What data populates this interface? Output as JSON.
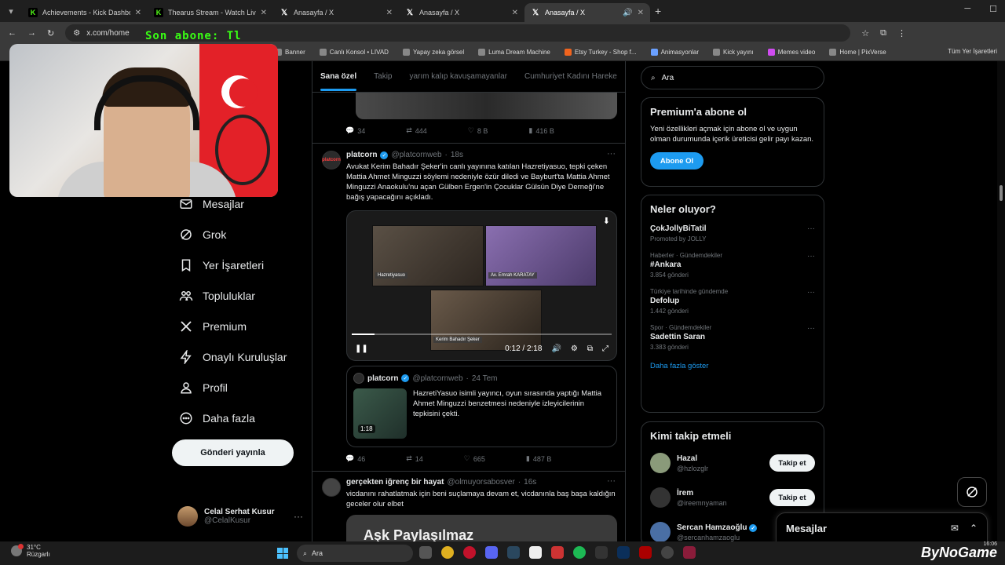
{
  "browser": {
    "tabs": [
      {
        "label": "Achievements - Kick Dashboard",
        "icon": "kick-icon",
        "active": false
      },
      {
        "label": "Thearus Stream - Watch Live on",
        "icon": "kick-icon",
        "active": false
      },
      {
        "label": "Anasayfa / X",
        "icon": "x-logo-icon",
        "active": false
      },
      {
        "label": "Anasayfa / X",
        "icon": "x-logo-icon",
        "active": false
      },
      {
        "label": "Anasayfa / X",
        "icon": "x-logo-icon",
        "active": true
      }
    ],
    "url": "x.com/home",
    "bookmarks": [
      "Banner",
      "Canlı Konsol • LIVAD",
      "Yapay zeka görsel",
      "Luma Dream Machine",
      "Etsy Turkey - Shop f...",
      "Animasyonlar",
      "Kick yayını",
      "Memes video",
      "Home | PixVerse"
    ],
    "bookmarks_right": "Tüm Yer İşaretleri"
  },
  "overlay": {
    "text": "Son abone: Tl"
  },
  "nav": {
    "items": [
      {
        "label": "Mesajlar",
        "icon": "mail-icon"
      },
      {
        "label": "Grok",
        "icon": "grok-icon"
      },
      {
        "label": "Yer İşaretleri",
        "icon": "bookmark-icon"
      },
      {
        "label": "Topluluklar",
        "icon": "communities-icon"
      },
      {
        "label": "Premium",
        "icon": "x-logo-icon"
      },
      {
        "label": "Onaylı Kuruluşlar",
        "icon": "lightning-icon"
      },
      {
        "label": "Profil",
        "icon": "user-icon"
      },
      {
        "label": "Daha fazla",
        "icon": "more-circle-icon"
      }
    ],
    "post_button": "Gönderi yayınla",
    "profile": {
      "name": "Celal Serhat Kusur",
      "handle": "@CelalKusur"
    }
  },
  "feed": {
    "tabs": [
      "Sana özel",
      "Takip",
      "yarım kalıp kavuşamayanlar",
      "Cumhuriyet Kadını Hareke"
    ],
    "prev_actions": {
      "replies": "34",
      "reposts": "444",
      "likes": "8 B",
      "views": "416 B"
    },
    "tweet1": {
      "name": "platcorn",
      "handle": "@platcornweb",
      "time": "18s",
      "avatar_text": "platcorn",
      "text": "Avukat Kerim Bahadır Şeker'in canlı yayınına katılan Hazretiyasuo, tepki çeken Mattia Ahmet Minguzzi söylemi nedeniyle özür diledi ve Bayburt'ta Mattia Ahmet Minguzzi Anaokulu'nu açan Gülben Ergen'in Çocuklar Gülsün Diye Derneği'ne bağış yapacağını açıkladı.",
      "video": {
        "labels": [
          "Hazretiyasuo",
          "Av. Emrah KARATAY",
          "Kerim Bahadır Şeker"
        ],
        "time": "0:12 / 2:18",
        "progress": 0.087
      },
      "quote": {
        "name": "platcorn",
        "handle": "@platcornweb",
        "time": "24 Tem",
        "text": "HazretiYasuo isimli yayıncı, oyun sırasında yaptığı Mattia Ahmet Minguzzi benzetmesi nedeniyle izleyicilerinin tepkisini çekti.",
        "duration": "1:18"
      },
      "actions": {
        "replies": "46",
        "reposts": "14",
        "likes": "665",
        "views": "487 B"
      }
    },
    "tweet2": {
      "name": "gerçekten iğrenç bir hayat",
      "handle": "@olmuyorsabosver",
      "time": "16s",
      "text": "vicdanını rahatlatmak için beni suçlamaya devam et, vicdanınla baş başa kaldığın geceler olur elbet",
      "media_text": "Aşk Paylaşılmaz"
    }
  },
  "sidebar": {
    "search_placeholder": "Ara",
    "premium": {
      "title": "Premium'a abone ol",
      "text": "Yeni özellikleri açmak için abone ol ve uygun olman durumunda içerik üreticisi gelir payı kazan.",
      "button": "Abone Ol"
    },
    "trends": {
      "title": "Neler oluyor?",
      "items": [
        {
          "meta": "",
          "name": "ÇokJollyBiTatil",
          "count": "Promoted by JOLLY"
        },
        {
          "meta": "Haberler · Gündemdekiler",
          "name": "#Ankara",
          "count": "3.854 gönderi"
        },
        {
          "meta": "Türkiye tarihinde gündemde",
          "name": "Defolup",
          "count": "1.442 gönderi"
        },
        {
          "meta": "Spor · Gündemdekiler",
          "name": "Sadettin Saran",
          "count": "3.383 gönderi"
        }
      ],
      "more": "Daha fazla göster"
    },
    "who_to_follow": {
      "title": "Kimi takip etmeli",
      "items": [
        {
          "name": "Hazal",
          "handle": "@hzlozglr",
          "button": "Takip et"
        },
        {
          "name": "İrem",
          "handle": "@ireemnyaman",
          "button": "Takip et"
        },
        {
          "name": "Sercan Hamzaoğlu",
          "handle": "@sercanhamzaoglu",
          "button": ""
        }
      ]
    },
    "messages_dock": "Mesajlar"
  },
  "taskbar": {
    "weather_temp": "31°C",
    "weather_desc": "Rüzgarlı",
    "search": "Ara",
    "clock": "16:06",
    "brand": "ByNoGame"
  }
}
